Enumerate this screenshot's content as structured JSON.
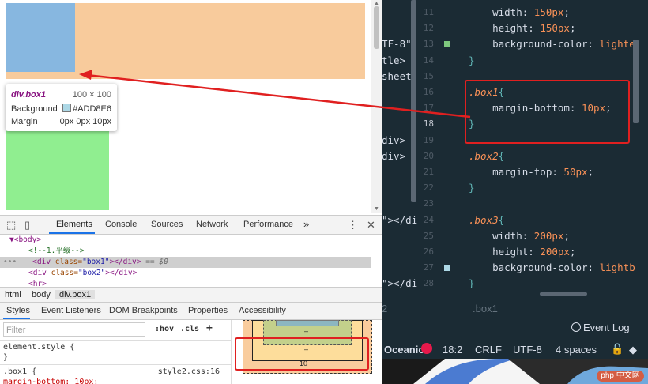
{
  "tooltip": {
    "selector": "div.box1",
    "size": "100 × 100",
    "bg_label": "Background",
    "bg_value": "#ADD8E6",
    "margin_label": "Margin",
    "margin_value": "0px 0px 10px"
  },
  "devtools": {
    "tabs": [
      "Elements",
      "Console",
      "Sources",
      "Network",
      "Performance"
    ],
    "more": "»",
    "dom": {
      "body_open": "<body>",
      "comment": "<!--1.平级-->",
      "line_box1_open": "<div ",
      "line_box1_attr": "class=",
      "line_box1_val": "\"box1\"",
      "line_box1_close": "></div>",
      "line_box1_suffix": " == $0",
      "line_box2_val": "\"box2\"",
      "hr": "<hr>"
    },
    "breadcrumbs": [
      "html",
      "body",
      "div.box1"
    ],
    "subtabs": [
      "Styles",
      "Event Listeners",
      "DOM Breakpoints",
      "Properties",
      "Accessibility"
    ],
    "filter_placeholder": "Filter",
    "hov": ":hov",
    "cls": ".cls",
    "plus": "+",
    "element_style": "element.style {",
    "close_brace": "}",
    "rule_selector": ".box1 {",
    "rule_source": "style2.css:16",
    "rule_partial": "  margin-bottom: 10px;",
    "boxmodel": {
      "content_dash": "–",
      "border_dash": "–",
      "margin_bottom": "10"
    }
  },
  "editor": {
    "lines": [
      {
        "n": "11",
        "left": "",
        "code": [
          [
            "prop",
            "    width: "
          ],
          [
            "val",
            "150px"
          ],
          [
            "punc",
            ";"
          ]
        ]
      },
      {
        "n": "12",
        "left": "",
        "code": [
          [
            "prop",
            "    height: "
          ],
          [
            "val",
            "150px"
          ],
          [
            "punc",
            ";"
          ]
        ]
      },
      {
        "n": "13",
        "left": "TF-8\"",
        "code": [
          [
            "prop",
            "    background-color: "
          ],
          [
            "val",
            "lighte"
          ]
        ]
      },
      {
        "n": "14",
        "left": "tle>",
        "code": [
          [
            "brace",
            "}"
          ]
        ]
      },
      {
        "n": "15",
        "left": "sheet",
        "code": []
      },
      {
        "n": "16",
        "left": "",
        "code": [
          [
            "sel",
            ".box1"
          ],
          [
            "brace",
            "{"
          ]
        ]
      },
      {
        "n": "17",
        "left": "",
        "code": [
          [
            "prop",
            "    margin-bottom: "
          ],
          [
            "val",
            "10px"
          ],
          [
            "punc",
            ";"
          ]
        ]
      },
      {
        "n": "18",
        "left": "",
        "code": [
          [
            "brace",
            "}"
          ]
        ]
      },
      {
        "n": "19",
        "left": "div>",
        "code": []
      },
      {
        "n": "20",
        "left": "div>",
        "code": [
          [
            "sel",
            ".box2"
          ],
          [
            "brace",
            "{"
          ]
        ]
      },
      {
        "n": "21",
        "left": "",
        "code": [
          [
            "prop",
            "    margin-top: "
          ],
          [
            "val",
            "50px"
          ],
          [
            "punc",
            ";"
          ]
        ]
      },
      {
        "n": "22",
        "left": "",
        "code": [
          [
            "brace",
            "}"
          ]
        ]
      },
      {
        "n": "23",
        "left": "",
        "code": []
      },
      {
        "n": "24",
        "left": "\"></di",
        "code": [
          [
            "sel",
            ".box3"
          ],
          [
            "brace",
            "{"
          ]
        ]
      },
      {
        "n": "25",
        "left": "",
        "code": [
          [
            "prop",
            "    width: "
          ],
          [
            "val",
            "200px"
          ],
          [
            "punc",
            ";"
          ]
        ]
      },
      {
        "n": "26",
        "left": "",
        "code": [
          [
            "prop",
            "    height: "
          ],
          [
            "val",
            "200px"
          ],
          [
            "punc",
            ";"
          ]
        ]
      },
      {
        "n": "27",
        "left": "",
        "code": [
          [
            "prop",
            "    background-color: "
          ],
          [
            "val",
            "lightb"
          ]
        ]
      },
      {
        "n": "28",
        "left": "\"></di",
        "code": [
          [
            "brace",
            "}"
          ]
        ]
      }
    ],
    "status": {
      "left_num": "2",
      "selector_crumb": ".box1",
      "event_log": "Event Log",
      "theme": "Oceanic",
      "position": "18:2",
      "line_ending": "CRLF",
      "encoding": "UTF-8",
      "indent": "4 spaces"
    }
  },
  "watermark": "php 中文网",
  "colors": {
    "red_annotation": "#e02020",
    "editor_bg": "#1b2b34"
  }
}
